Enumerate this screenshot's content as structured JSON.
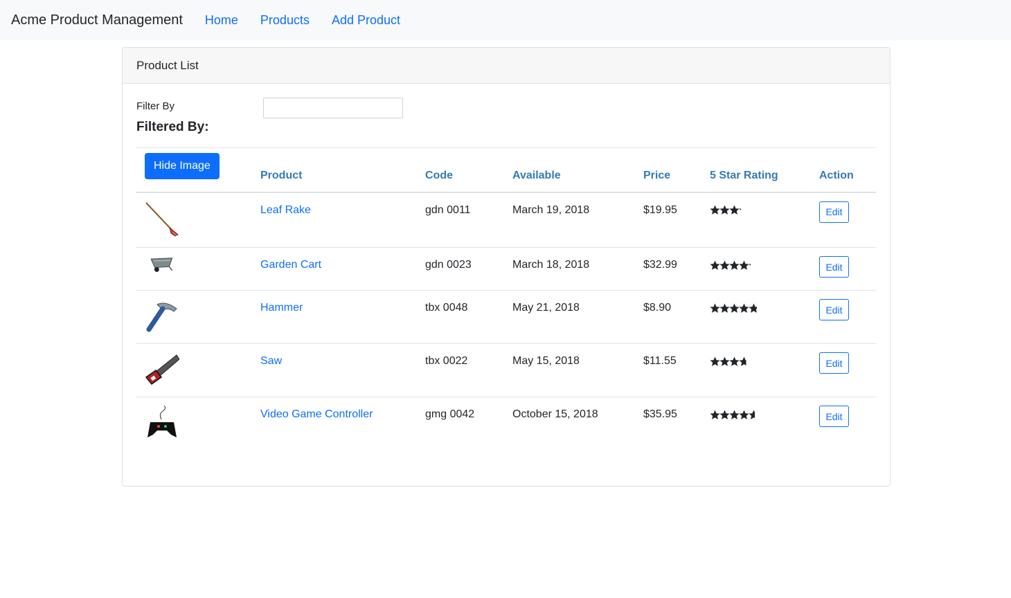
{
  "navbar": {
    "brand": "Acme Product Management",
    "links": [
      {
        "label": "Home"
      },
      {
        "label": "Products"
      },
      {
        "label": "Add Product"
      }
    ]
  },
  "card": {
    "title": "Product List",
    "filter_label": "Filter By",
    "filter_value": "",
    "filtered_by_label": "Filtered By:",
    "hide_image_label": "Hide Image"
  },
  "table": {
    "headers": {
      "product": "Product",
      "code": "Code",
      "available": "Available",
      "price": "Price",
      "rating": "5 Star Rating",
      "action": "Action"
    },
    "edit_label": "Edit",
    "rows": [
      {
        "name": "Leaf Rake",
        "code": "gdn 0011",
        "available": "March 19, 2018",
        "price": "$19.95",
        "rating": 3.2,
        "image_icon": "leaf-rake-icon"
      },
      {
        "name": "Garden Cart",
        "code": "gdn 0023",
        "available": "March 18, 2018",
        "price": "$32.99",
        "rating": 4.2,
        "image_icon": "garden-cart-icon"
      },
      {
        "name": "Hammer",
        "code": "tbx 0048",
        "available": "May 21, 2018",
        "price": "$8.90",
        "rating": 4.8,
        "image_icon": "hammer-icon"
      },
      {
        "name": "Saw",
        "code": "tbx 0022",
        "available": "May 15, 2018",
        "price": "$11.55",
        "rating": 3.7,
        "image_icon": "saw-icon"
      },
      {
        "name": "Video Game Controller",
        "code": "gmg 0042",
        "available": "October 15, 2018",
        "price": "$35.95",
        "rating": 4.6,
        "image_icon": "game-controller-icon"
      }
    ]
  },
  "colors": {
    "link": "#0d6efd",
    "header_text": "#337ab7",
    "star": "#212529"
  }
}
